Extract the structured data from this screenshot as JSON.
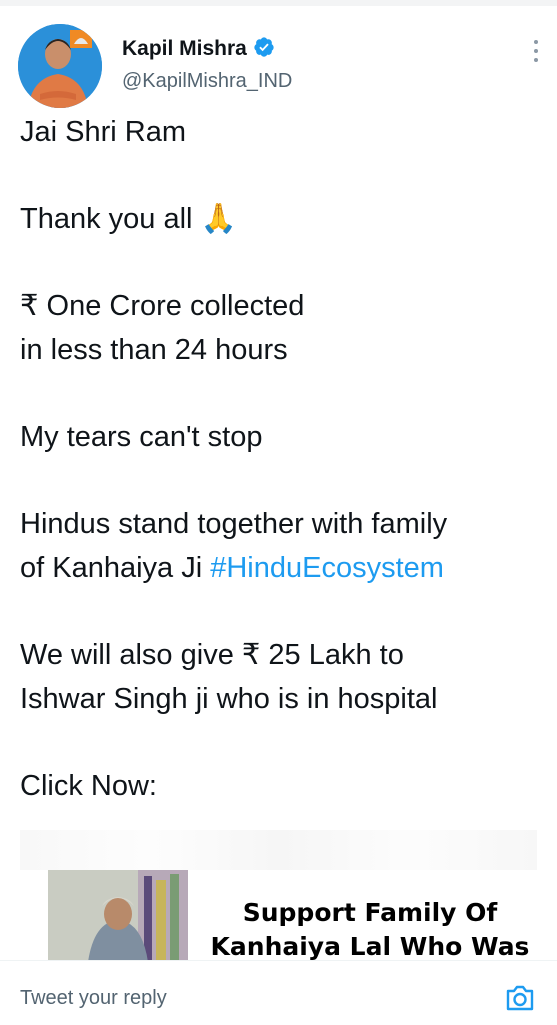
{
  "tweet": {
    "author_name": "Kapil Mishra",
    "author_handle": "@KapilMishra_IND",
    "paragraphs": [
      [
        "Jai Shri Ram"
      ],
      [
        "Thank you all 🙏"
      ],
      [
        "₹ One Crore collected",
        "in less than 24 hours"
      ],
      [
        "My tears can't stop"
      ],
      [
        "Hindus stand together with family",
        "of Kanhaiya Ji "
      ],
      [
        "We will also give ₹ 25 Lakh to",
        "Ishwar Singh ji who is in hospital"
      ],
      [
        "Click Now:"
      ]
    ],
    "hashtag": "#HinduEcosystem"
  },
  "link_card": {
    "title_line1": "Support Family Of",
    "title_line2": "Kanhaiya Lal Who Was"
  },
  "reply": {
    "placeholder": "Tweet your reply"
  },
  "colors": {
    "link_blue": "#1d9bf0",
    "verified_blue": "#1d9bf0",
    "secondary_text": "#536471"
  },
  "icons": [
    "verified-badge-icon",
    "more-options-icon",
    "camera-icon",
    "folded-hands-emoji"
  ]
}
